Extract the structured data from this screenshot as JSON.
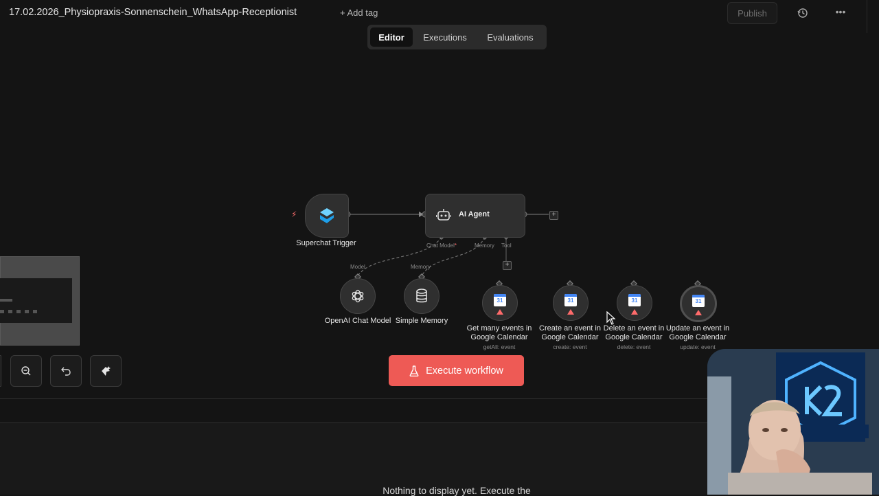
{
  "header": {
    "workflow_title": "17.02.2026_Physiopraxis-Sonnenschein_WhatsApp-Receptionist",
    "add_tag_label": "+ Add tag",
    "publish_label": "Publish"
  },
  "tabs": [
    {
      "label": "Editor",
      "active": true
    },
    {
      "label": "Executions",
      "active": false
    },
    {
      "label": "Evaluations",
      "active": false
    }
  ],
  "nodes": {
    "trigger": {
      "label": "Superchat Trigger"
    },
    "agent": {
      "label": "AI Agent",
      "ports": {
        "chat_model": "Chat Model",
        "chat_model_required": "*",
        "memory": "Memory",
        "tool": "Tool"
      }
    },
    "openai": {
      "label": "OpenAI Chat Model",
      "port": "Model"
    },
    "memory": {
      "label": "Simple Memory",
      "port": "Memory"
    },
    "tools": [
      {
        "label_line1": "Get many events in",
        "label_line2": "Google Calendar",
        "sub": "getAll: event"
      },
      {
        "label_line1": "Create an event in",
        "label_line2": "Google Calendar",
        "sub": "create: event"
      },
      {
        "label_line1": "Delete an event in",
        "label_line2": "Google Calendar",
        "sub": "delete: event"
      },
      {
        "label_line1": "Update an event in",
        "label_line2": "Google Calendar",
        "sub": "update: event"
      }
    ],
    "calendar_icon_text": "31"
  },
  "execute_label": "Execute workflow",
  "panel": {
    "empty_text": "Nothing to display yet. Execute the"
  },
  "colors": {
    "accent": "#ee5a55",
    "background": "#141414",
    "node": "#2f2f2f"
  },
  "icons": [
    "history-icon",
    "more-icon",
    "bolt-icon",
    "superchat-icon",
    "robot-icon",
    "openai-icon",
    "database-icon",
    "google-calendar-icon",
    "warning-icon",
    "zoom-out-icon",
    "undo-icon",
    "tidy-up-icon",
    "flask-icon"
  ]
}
